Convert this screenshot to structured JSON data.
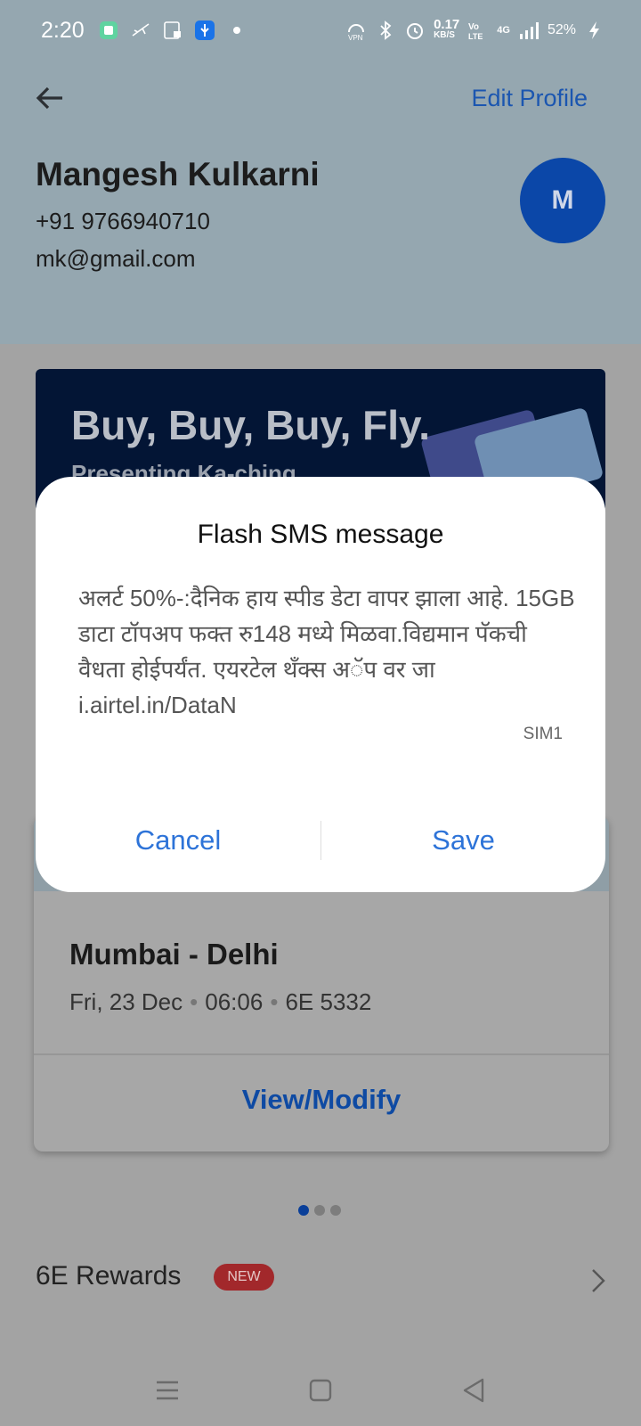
{
  "status_bar": {
    "time": "2:20",
    "speed": "0.17",
    "speed_unit": "KB/S",
    "network": "4G",
    "battery": "52%"
  },
  "header": {
    "edit_profile": "Edit Profile",
    "name": "Mangesh Kulkarni",
    "phone": "+91 9766940710",
    "email": "mk@gmail.com",
    "avatar_initial": "M"
  },
  "banner": {
    "title": "Buy, Buy, Buy, Fly.",
    "subtitle": "Presenting Ka-ching"
  },
  "flight": {
    "route": "Mumbai - Delhi",
    "date": "Fri, 23 Dec",
    "time": "06:06",
    "flight_no": "6E 5332",
    "action": "View/Modify"
  },
  "rewards": {
    "label": "6E Rewards",
    "badge": "NEW"
  },
  "dialog": {
    "title": "Flash SMS message",
    "body": "अलर्ट 50%-:दैनिक हाय स्पीड डेटा वापर झाला आहे. 15GB डाटा टॉपअप फक्त रु148 मध्ये मिळवा.विद्यमान पॅकची वैधता होईपर्यंत. एयरटेल थँक्स अॅप वर जा i.airtel.in/DataN",
    "sim": "SIM1",
    "cancel": "Cancel",
    "save": "Save"
  },
  "colors": {
    "accent": "#2d73d8",
    "header_bg": "#95a7b0",
    "avatar": "#0b47a8",
    "badge": "#a2282b"
  }
}
